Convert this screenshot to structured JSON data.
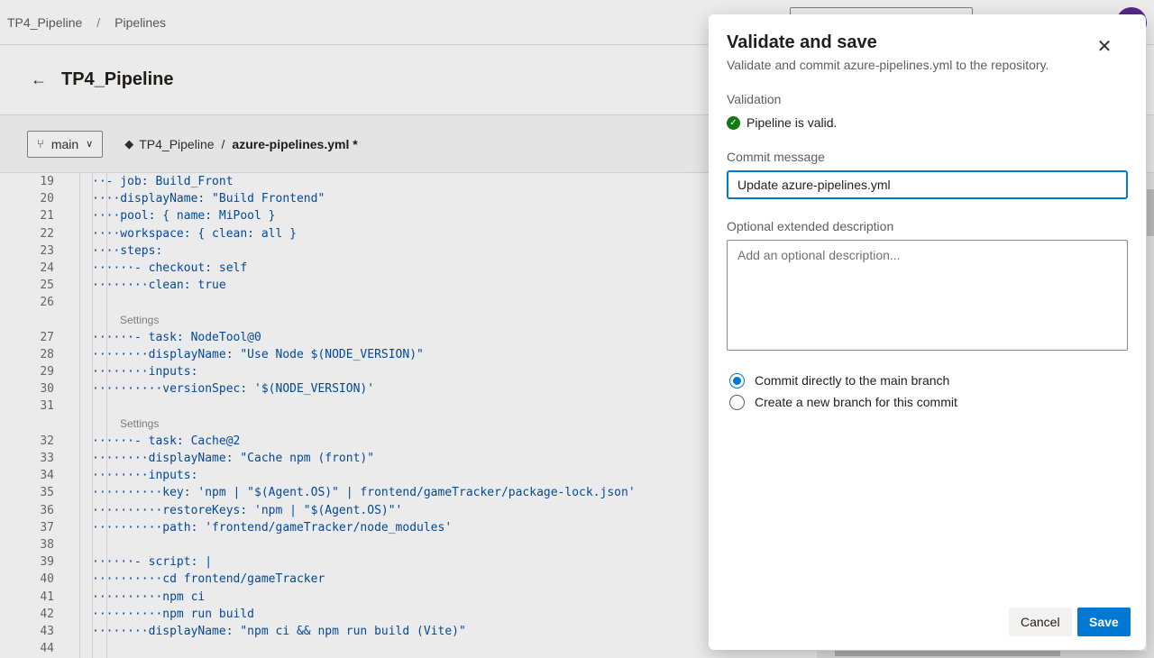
{
  "breadcrumb": {
    "project": "TP4_Pipeline",
    "separator": "/",
    "section": "Pipelines"
  },
  "page": {
    "back_icon": "←",
    "title": "TP4_Pipeline"
  },
  "toolbar": {
    "branch_icon": "⑂",
    "branch": "main",
    "chevron": "∨",
    "repo_icon": "◆",
    "repo": "TP4_Pipeline",
    "path_separator": "/",
    "file": "azure-pipelines.yml *"
  },
  "editor": {
    "lines": [
      {
        "num": "19",
        "code": "··- job: Build_Front"
      },
      {
        "num": "20",
        "code": "····displayName: \"Build Frontend\""
      },
      {
        "num": "21",
        "code": "····pool: { name: MiPool }"
      },
      {
        "num": "22",
        "code": "····workspace: { clean: all }"
      },
      {
        "num": "23",
        "code": "····steps:"
      },
      {
        "num": "24",
        "code": "······- checkout: self"
      },
      {
        "num": "25",
        "code": "········clean: true"
      },
      {
        "num": "26",
        "code": ""
      },
      {
        "settings": "Settings"
      },
      {
        "num": "27",
        "code": "······- task: NodeTool@0"
      },
      {
        "num": "28",
        "code": "········displayName: \"Use Node $(NODE_VERSION)\""
      },
      {
        "num": "29",
        "code": "········inputs:"
      },
      {
        "num": "30",
        "code": "··········versionSpec: '$(NODE_VERSION)'"
      },
      {
        "num": "31",
        "code": ""
      },
      {
        "settings": "Settings"
      },
      {
        "num": "32",
        "code": "······- task: Cache@2"
      },
      {
        "num": "33",
        "code": "········displayName: \"Cache npm (front)\""
      },
      {
        "num": "34",
        "code": "········inputs:"
      },
      {
        "num": "35",
        "code": "··········key: 'npm | \"$(Agent.OS)\" | frontend/gameTracker/package-lock.json'"
      },
      {
        "num": "36",
        "code": "··········restoreKeys: 'npm | \"$(Agent.OS)\"'"
      },
      {
        "num": "37",
        "code": "··········path: 'frontend/gameTracker/node_modules'"
      },
      {
        "num": "38",
        "code": ""
      },
      {
        "num": "39",
        "code": "······- script: |"
      },
      {
        "num": "40",
        "code": "··········cd frontend/gameTracker"
      },
      {
        "num": "41",
        "code": "··········npm ci"
      },
      {
        "num": "42",
        "code": "··········npm run build"
      },
      {
        "num": "43",
        "code": "········displayName: \"npm ci && npm run build (Vite)\""
      },
      {
        "num": "44",
        "code": ""
      }
    ]
  },
  "dialog": {
    "title": "Validate and save",
    "subtitle": "Validate and commit azure-pipelines.yml to the repository.",
    "close_icon": "✕",
    "validation_label": "Validation",
    "check_icon": "✓",
    "validation_status": "Pipeline is valid.",
    "commit_label": "Commit message",
    "commit_value": "Update azure-pipelines.yml",
    "description_label": "Optional extended description",
    "description_placeholder": "Add an optional description...",
    "options": [
      {
        "label": "Commit directly to the main branch",
        "selected": true
      },
      {
        "label": "Create a new branch for this commit",
        "selected": false
      }
    ],
    "cancel_label": "Cancel",
    "save_label": "Save"
  },
  "colors": {
    "accent": "#0078d4",
    "success": "#107c10",
    "avatar": "#5c2d91"
  }
}
